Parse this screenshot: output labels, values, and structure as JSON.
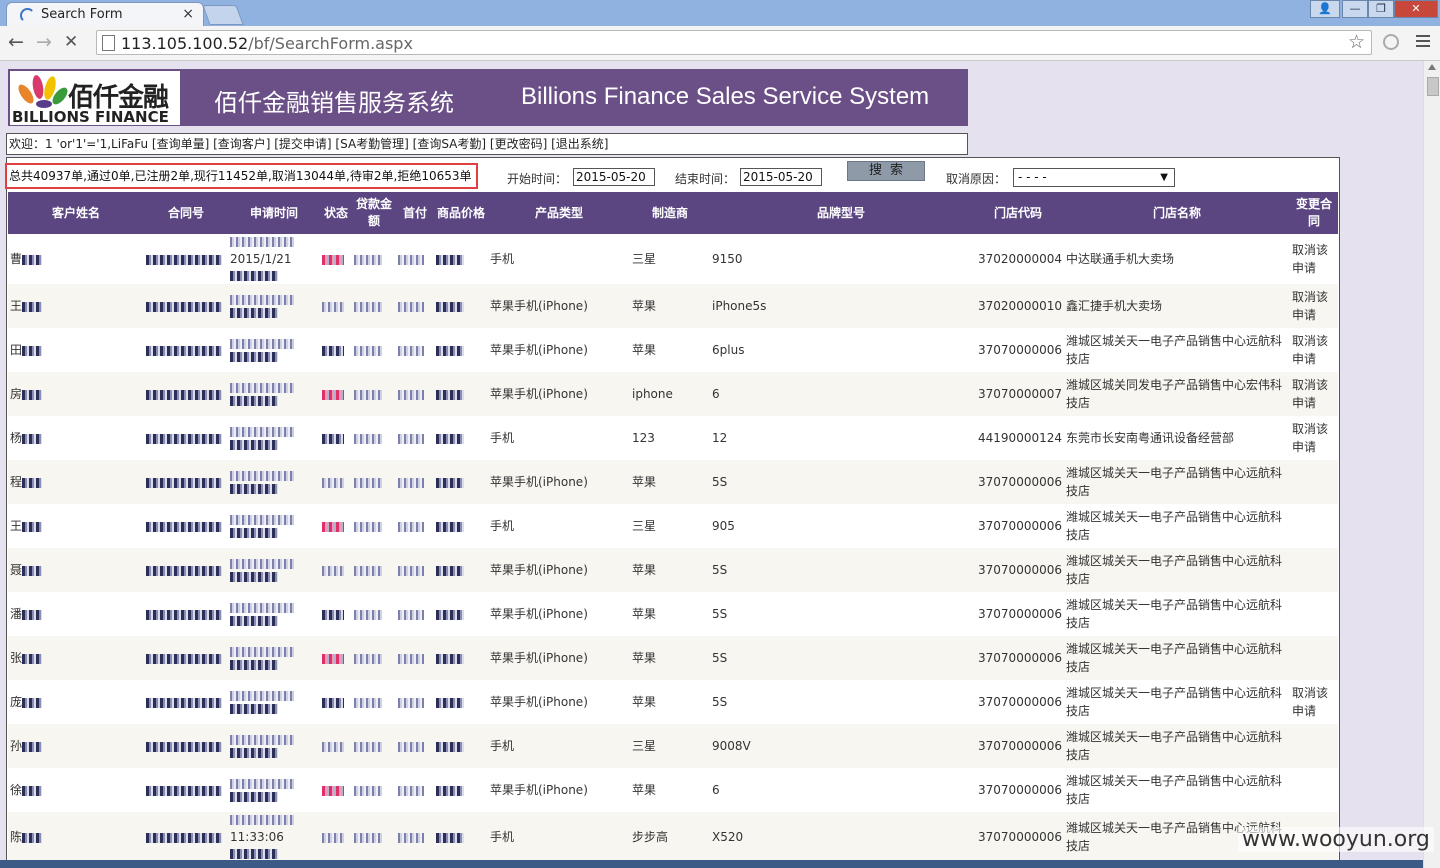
{
  "browser": {
    "tab_title": "Search Form",
    "tab_close": "×",
    "url_host": "113.105.100.52",
    "url_path": "/bf/SearchForm.aspx",
    "back": "←",
    "forward": "→",
    "stop": "✕",
    "star": "☆",
    "win_user": "👤",
    "win_min": "—",
    "win_restore": "❐",
    "win_close": "✕"
  },
  "banner": {
    "logo_cn": "佰仟金融",
    "logo_en": "BILLIONS FINANCE",
    "title_cn": "佰仟金融销售服务系统",
    "title_en": "Billions Finance Sales Service System"
  },
  "welcome_bar": "欢迎：1 'or'1'='1,LiFaFu [查询单量] [查询客户] [提交申请] [SA考勤管理] [查询SA考勤] [更改密码] [退出系统]",
  "filters": {
    "summary": "总共40937单,通过0单,已注册2单,现行11452单,取消13044单,待审2单,拒绝10653单",
    "start_label": "开始时间：",
    "start_value": "2015-05-20",
    "end_label": "结束时间：",
    "end_value": "2015-05-20",
    "search_label": "搜索",
    "cancel_label": "取消原因：",
    "cancel_value": "- - - -",
    "cancel_arrow": "▼"
  },
  "table": {
    "headers": [
      "客户姓名",
      "合同号",
      "申请时间",
      "状态",
      "贷款金额",
      "首付",
      "商品价格",
      "产品类型",
      "制造商",
      "品牌型号",
      "门店代码",
      "门店名称",
      "变更合同"
    ],
    "rows": [
      {
        "name": "曹",
        "time_top": "2015/1/21",
        "time_bottom": "",
        "type": "手机",
        "maker": "三星",
        "model": "9150",
        "code": "37020000004",
        "store": "中达联通手机大卖场",
        "action": "取消该申请"
      },
      {
        "name": "王",
        "time_top": "",
        "time_bottom": "",
        "type": "苹果手机(iPhone)",
        "maker": "苹果",
        "model": "iPhone5s",
        "code": "37020000010",
        "store": "鑫汇捷手机大卖场",
        "action": "取消该申请"
      },
      {
        "name": "田",
        "time_top": "",
        "time_bottom": "",
        "type": "苹果手机(iPhone)",
        "maker": "苹果",
        "model": "6plus",
        "code": "37070000006",
        "store": "潍城区城关天一电子产品销售中心远航科技店",
        "action": "取消该申请"
      },
      {
        "name": "房",
        "time_top": "",
        "time_bottom": "",
        "type": "苹果手机(iPhone)",
        "maker": "iphone",
        "model": "6",
        "code": "37070000007",
        "store": "潍城区城关同发电子产品销售中心宏伟科技店",
        "action": "取消该申请"
      },
      {
        "name": "杨",
        "time_top": "",
        "time_bottom": "",
        "type": "手机",
        "maker": "123",
        "model": "12",
        "code": "44190000124",
        "store": "东莞市长安南粤通讯设备经营部",
        "action": "取消该申请"
      },
      {
        "name": "程",
        "time_top": "",
        "time_bottom": "",
        "type": "苹果手机(iPhone)",
        "maker": "苹果",
        "model": "5S",
        "code": "37070000006",
        "store": "潍城区城关天一电子产品销售中心远航科技店",
        "action": ""
      },
      {
        "name": "王",
        "time_top": "",
        "time_bottom": "",
        "type": "手机",
        "maker": "三星",
        "model": "905",
        "code": "37070000006",
        "store": "潍城区城关天一电子产品销售中心远航科技店",
        "action": ""
      },
      {
        "name": "聂",
        "time_top": "",
        "time_bottom": "",
        "type": "苹果手机(iPhone)",
        "maker": "苹果",
        "model": "5S",
        "code": "37070000006",
        "store": "潍城区城关天一电子产品销售中心远航科技店",
        "action": ""
      },
      {
        "name": "潘",
        "time_top": "",
        "time_bottom": "",
        "type": "苹果手机(iPhone)",
        "maker": "苹果",
        "model": "5S",
        "code": "37070000006",
        "store": "潍城区城关天一电子产品销售中心远航科技店",
        "action": ""
      },
      {
        "name": "张",
        "time_top": "",
        "time_bottom": "",
        "type": "苹果手机(iPhone)",
        "maker": "苹果",
        "model": "5S",
        "code": "37070000006",
        "store": "潍城区城关天一电子产品销售中心远航科技店",
        "action": ""
      },
      {
        "name": "庞",
        "time_top": "",
        "time_bottom": "",
        "type": "苹果手机(iPhone)",
        "maker": "苹果",
        "model": "5S",
        "code": "37070000006",
        "store": "潍城区城关天一电子产品销售中心远航科技店",
        "action": "取消该申请"
      },
      {
        "name": "孙",
        "time_top": "",
        "time_bottom": "",
        "type": "手机",
        "maker": "三星",
        "model": "9008V",
        "code": "37070000006",
        "store": "潍城区城关天一电子产品销售中心远航科技店",
        "action": ""
      },
      {
        "name": "徐",
        "time_top": "",
        "time_bottom": "",
        "type": "苹果手机(iPhone)",
        "maker": "苹果",
        "model": "6",
        "code": "37070000006",
        "store": "潍城区城关天一电子产品销售中心远航科技店",
        "action": ""
      },
      {
        "name": "陈",
        "time_top": "",
        "time_bottom": "11:33:06",
        "type": "手机",
        "maker": "步步高",
        "model": "X520",
        "code": "37070000006",
        "store": "潍城区城关天一电子产品销售中心远航科技店",
        "action": ""
      }
    ]
  },
  "watermark": "www.wooyun.org"
}
